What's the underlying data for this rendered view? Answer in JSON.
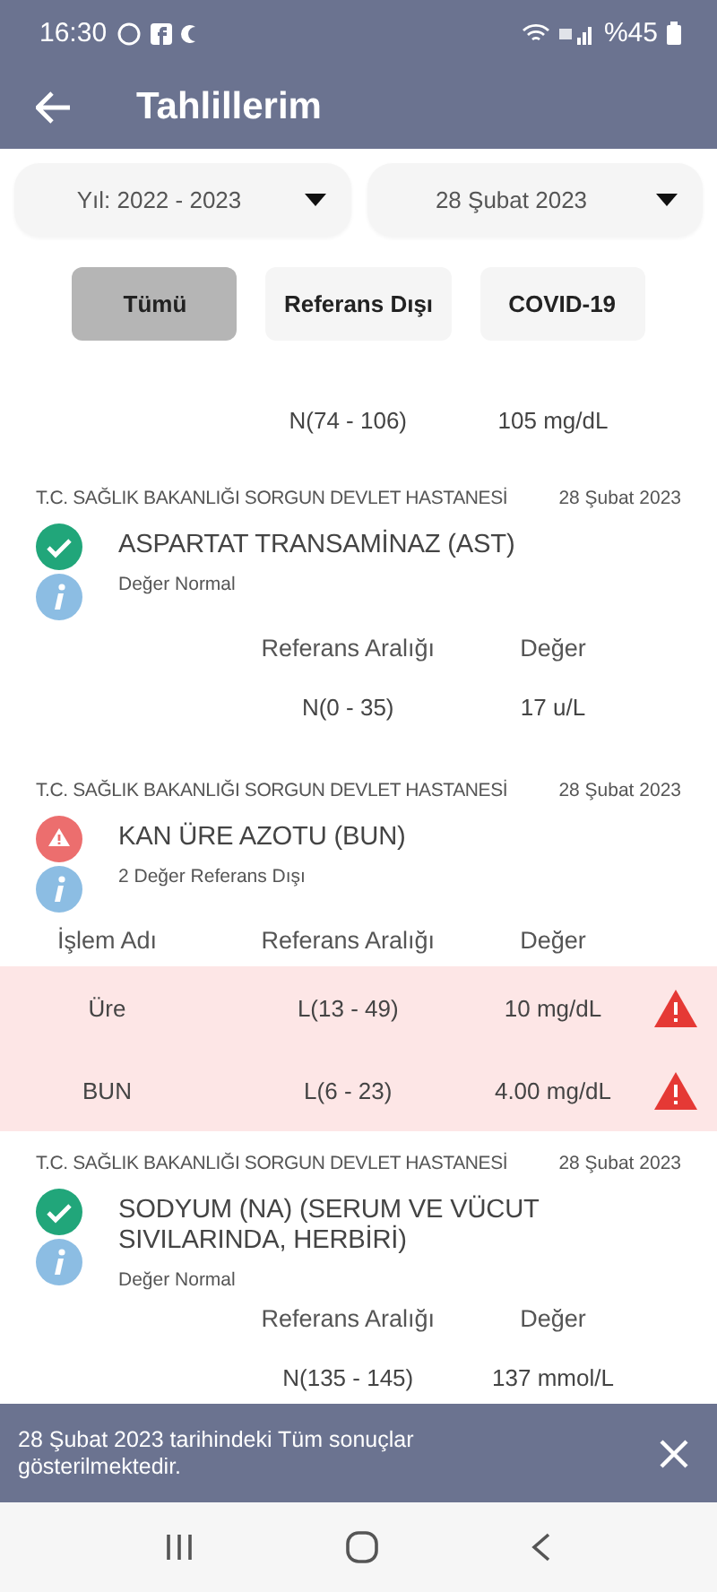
{
  "status_bar": {
    "time": "16:30",
    "battery": "%45"
  },
  "app_bar": {
    "title": "Tahlillerim"
  },
  "dropdowns": [
    {
      "value": "Yıl: 2022 - 2023"
    },
    {
      "value": "28 Şubat 2023"
    }
  ],
  "filters": [
    {
      "label": "Tümü",
      "selected": true
    },
    {
      "label": "Referans Dışı",
      "selected": false
    },
    {
      "label": "COVID-19",
      "selected": false
    }
  ],
  "results": [
    {
      "kind": "partial",
      "rows": [
        {
          "range": "N(74 - 106)",
          "value": "105 mg/dL",
          "out_of_range": false
        }
      ]
    },
    {
      "kind": "full",
      "hospital": "T.C. SAĞLIK BAKANLIĞI SORGUN DEVLET HASTANESİ",
      "date": "28 Şubat 2023",
      "normal": true,
      "title": "ASPARTAT TRANSAMİNAZ (AST)",
      "note": "Değer Normal",
      "columns": [
        "Referans Aralığı",
        "Değer"
      ],
      "rows": [
        {
          "range": "N(0 - 35)",
          "value": "17 u/L",
          "out_of_range": false
        }
      ]
    },
    {
      "kind": "full",
      "hospital": "T.C. SAĞLIK BAKANLIĞI SORGUN DEVLET HASTANESİ",
      "date": "28 Şubat 2023",
      "normal": false,
      "title": "KAN ÜRE AZOTU (BUN)",
      "note": "2 Değer Referans Dışı",
      "columns": [
        "İşlem Adı",
        "Referans Aralığı",
        "Değer"
      ],
      "rows": [
        {
          "name": "Üre",
          "range": "L(13 - 49)",
          "value": "10 mg/dL",
          "out_of_range": true
        },
        {
          "name": "BUN",
          "range": "L(6 - 23)",
          "value": "4.00 mg/dL",
          "out_of_range": true
        }
      ]
    },
    {
      "kind": "full",
      "hospital": "T.C. SAĞLIK BAKANLIĞI SORGUN DEVLET HASTANESİ",
      "date": "28 Şubat 2023",
      "normal": true,
      "title": "SODYUM (NA) (SERUM VE VÜCUT SIVILARINDA, HERBİRİ)",
      "note": "Değer Normal",
      "columns": [
        "Referans Aralığı",
        "Değer"
      ],
      "rows": [
        {
          "range": "N(135 - 145)",
          "value": "137 mmol/L",
          "out_of_range": false
        }
      ]
    }
  ],
  "snackbar": {
    "message": "28 Şubat 2023 tarihindeki Tüm sonuçlar gösterilmektedir."
  }
}
